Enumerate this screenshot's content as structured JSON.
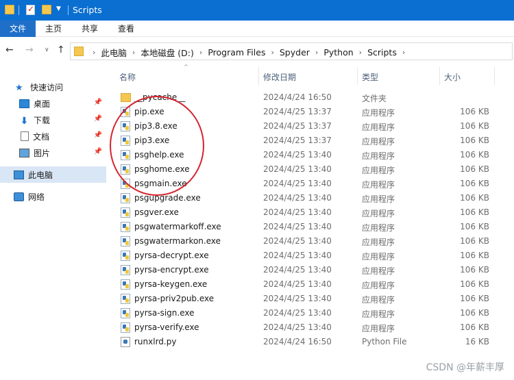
{
  "window": {
    "title": "Scripts"
  },
  "ribbon": {
    "tabs": [
      "文件",
      "主页",
      "共享",
      "查看"
    ]
  },
  "address": {
    "crumbs": [
      "此电脑",
      "本地磁盘 (D:)",
      "Program Files",
      "Spyder",
      "Python",
      "Scripts"
    ]
  },
  "sidebar": {
    "quick_access": "快速访问",
    "items": [
      {
        "label": "桌面",
        "icon": "desktop-icon",
        "pinned": true
      },
      {
        "label": "下载",
        "icon": "downloads-icon",
        "pinned": true
      },
      {
        "label": "文档",
        "icon": "documents-icon",
        "pinned": true
      },
      {
        "label": "图片",
        "icon": "pictures-icon",
        "pinned": true
      }
    ],
    "this_pc": "此电脑",
    "network": "网络"
  },
  "columns": {
    "name": "名称",
    "date": "修改日期",
    "type": "类型",
    "size": "大小"
  },
  "files": [
    {
      "name": "__pycache__",
      "date": "2024/4/24 16:50",
      "type": "文件夹",
      "size": "",
      "icon": "folder-icon"
    },
    {
      "name": "pip.exe",
      "date": "2024/4/25 13:37",
      "type": "应用程序",
      "size": "106 KB",
      "icon": "exe-icon"
    },
    {
      "name": "pip3.8.exe",
      "date": "2024/4/25 13:37",
      "type": "应用程序",
      "size": "106 KB",
      "icon": "exe-icon"
    },
    {
      "name": "pip3.exe",
      "date": "2024/4/25 13:37",
      "type": "应用程序",
      "size": "106 KB",
      "icon": "exe-icon"
    },
    {
      "name": "psghelp.exe",
      "date": "2024/4/25 13:40",
      "type": "应用程序",
      "size": "106 KB",
      "icon": "exe-icon"
    },
    {
      "name": "psghome.exe",
      "date": "2024/4/25 13:40",
      "type": "应用程序",
      "size": "106 KB",
      "icon": "exe-icon"
    },
    {
      "name": "psgmain.exe",
      "date": "2024/4/25 13:40",
      "type": "应用程序",
      "size": "106 KB",
      "icon": "exe-icon"
    },
    {
      "name": "psgupgrade.exe",
      "date": "2024/4/25 13:40",
      "type": "应用程序",
      "size": "106 KB",
      "icon": "exe-icon"
    },
    {
      "name": "psgver.exe",
      "date": "2024/4/25 13:40",
      "type": "应用程序",
      "size": "106 KB",
      "icon": "exe-icon"
    },
    {
      "name": "psgwatermarkoff.exe",
      "date": "2024/4/25 13:40",
      "type": "应用程序",
      "size": "106 KB",
      "icon": "exe-icon"
    },
    {
      "name": "psgwatermarkon.exe",
      "date": "2024/4/25 13:40",
      "type": "应用程序",
      "size": "106 KB",
      "icon": "exe-icon"
    },
    {
      "name": "pyrsa-decrypt.exe",
      "date": "2024/4/25 13:40",
      "type": "应用程序",
      "size": "106 KB",
      "icon": "exe-icon"
    },
    {
      "name": "pyrsa-encrypt.exe",
      "date": "2024/4/25 13:40",
      "type": "应用程序",
      "size": "106 KB",
      "icon": "exe-icon"
    },
    {
      "name": "pyrsa-keygen.exe",
      "date": "2024/4/25 13:40",
      "type": "应用程序",
      "size": "106 KB",
      "icon": "exe-icon"
    },
    {
      "name": "pyrsa-priv2pub.exe",
      "date": "2024/4/25 13:40",
      "type": "应用程序",
      "size": "106 KB",
      "icon": "exe-icon"
    },
    {
      "name": "pyrsa-sign.exe",
      "date": "2024/4/25 13:40",
      "type": "应用程序",
      "size": "106 KB",
      "icon": "exe-icon"
    },
    {
      "name": "pyrsa-verify.exe",
      "date": "2024/4/25 13:40",
      "type": "应用程序",
      "size": "106 KB",
      "icon": "exe-icon"
    },
    {
      "name": "runxlrd.py",
      "date": "2024/4/24 16:50",
      "type": "Python File",
      "size": "16 KB",
      "icon": "python-file-icon"
    }
  ],
  "watermark": "CSDN @年薪丰厚",
  "colors": {
    "titlebar": "#0a6fd1",
    "file_tab": "#1f6fc9",
    "selected": "#d9e6f5",
    "annotation": "#d4232e"
  }
}
